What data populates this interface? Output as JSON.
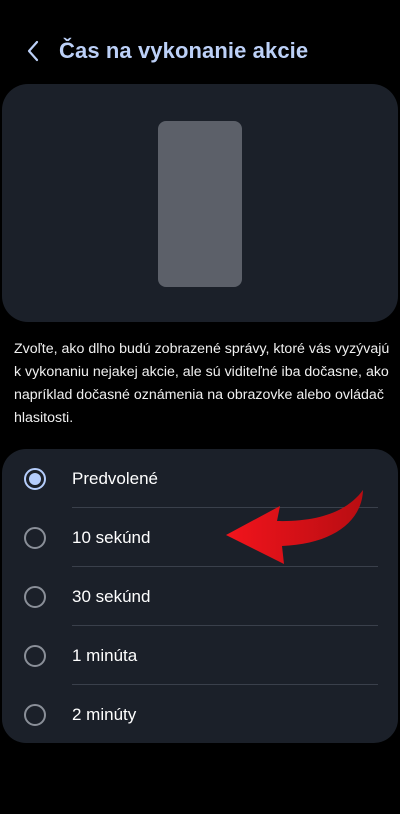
{
  "header": {
    "title": "Čas na vykonanie akcie",
    "back_icon": "chevron-left-icon"
  },
  "description": "Zvoľte, ako dlho budú zobrazené správy, ktoré vás vyzývajú k vykonaniu nejakej akcie, ale sú viditeľné iba dočasne, ako napríklad dočasné oznámenia na obrazovke alebo ovládač hlasitosti.",
  "options": [
    {
      "label": "Predvolené",
      "selected": true
    },
    {
      "label": "10 sekúnd",
      "selected": false
    },
    {
      "label": "30 sekúnd",
      "selected": false
    },
    {
      "label": "1 minúta",
      "selected": false
    },
    {
      "label": "2 minúty",
      "selected": false
    }
  ],
  "colors": {
    "background": "#000000",
    "card": "#1b2029",
    "accent": "#b5cdfb",
    "annotation_arrow": "#e3141b"
  }
}
